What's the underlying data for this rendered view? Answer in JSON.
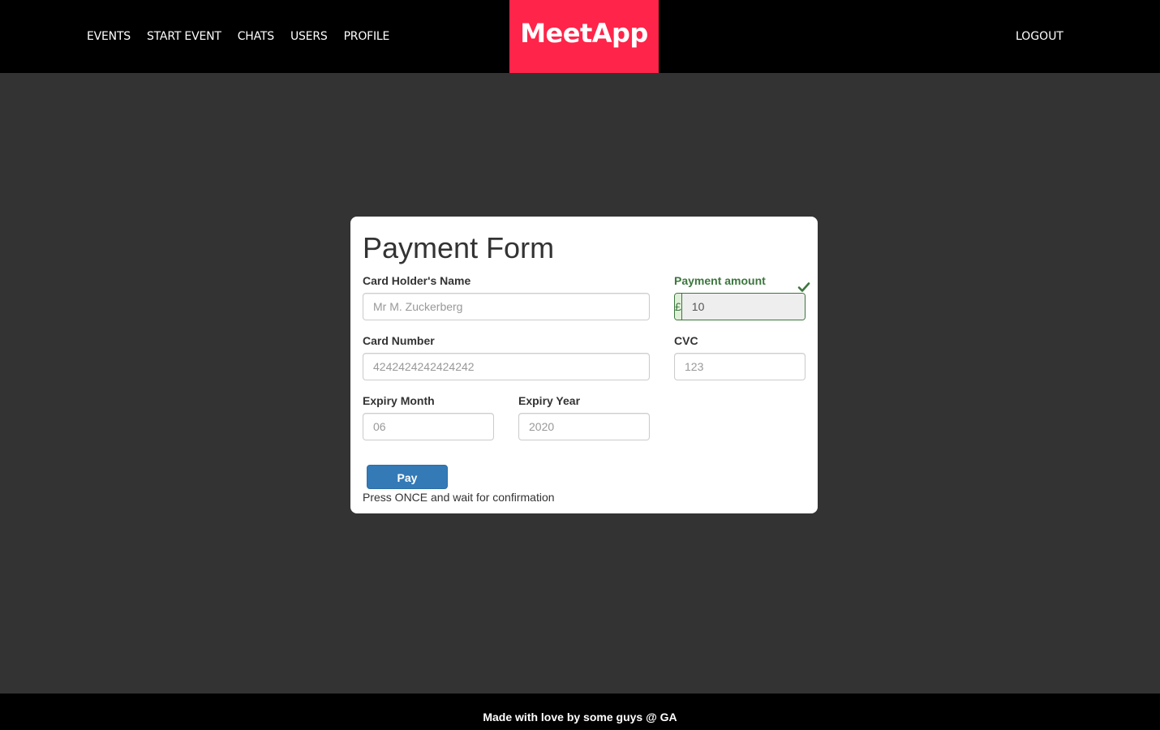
{
  "navbar": {
    "links": [
      "EVENTS",
      "START EVENT",
      "CHATS",
      "USERS",
      "PROFILE"
    ],
    "brand": "MeetApp",
    "logout": "LOGOUT",
    "brand_color": "#ff2449"
  },
  "form": {
    "title": "Payment Form",
    "card_holder": {
      "label": "Card Holder's Name",
      "placeholder": "Mr M. Zuckerberg"
    },
    "payment_amount": {
      "label": "Payment amount",
      "currency_symbol": "£",
      "value": "10",
      "status_icon": "checkmark-icon",
      "status_color": "#3c763d"
    },
    "card_number": {
      "label": "Card Number",
      "placeholder": "4242424242424242"
    },
    "cvc": {
      "label": "CVC",
      "placeholder": "123"
    },
    "expiry_month": {
      "label": "Expiry Month",
      "placeholder": "06"
    },
    "expiry_year": {
      "label": "Expiry Year",
      "placeholder": "2020"
    },
    "pay_button": "Pay",
    "pay_button_color": "#337ab7",
    "note": "Press ONCE and wait for confirmation"
  },
  "footer": {
    "text": "Made with love by some guys @ GA"
  }
}
